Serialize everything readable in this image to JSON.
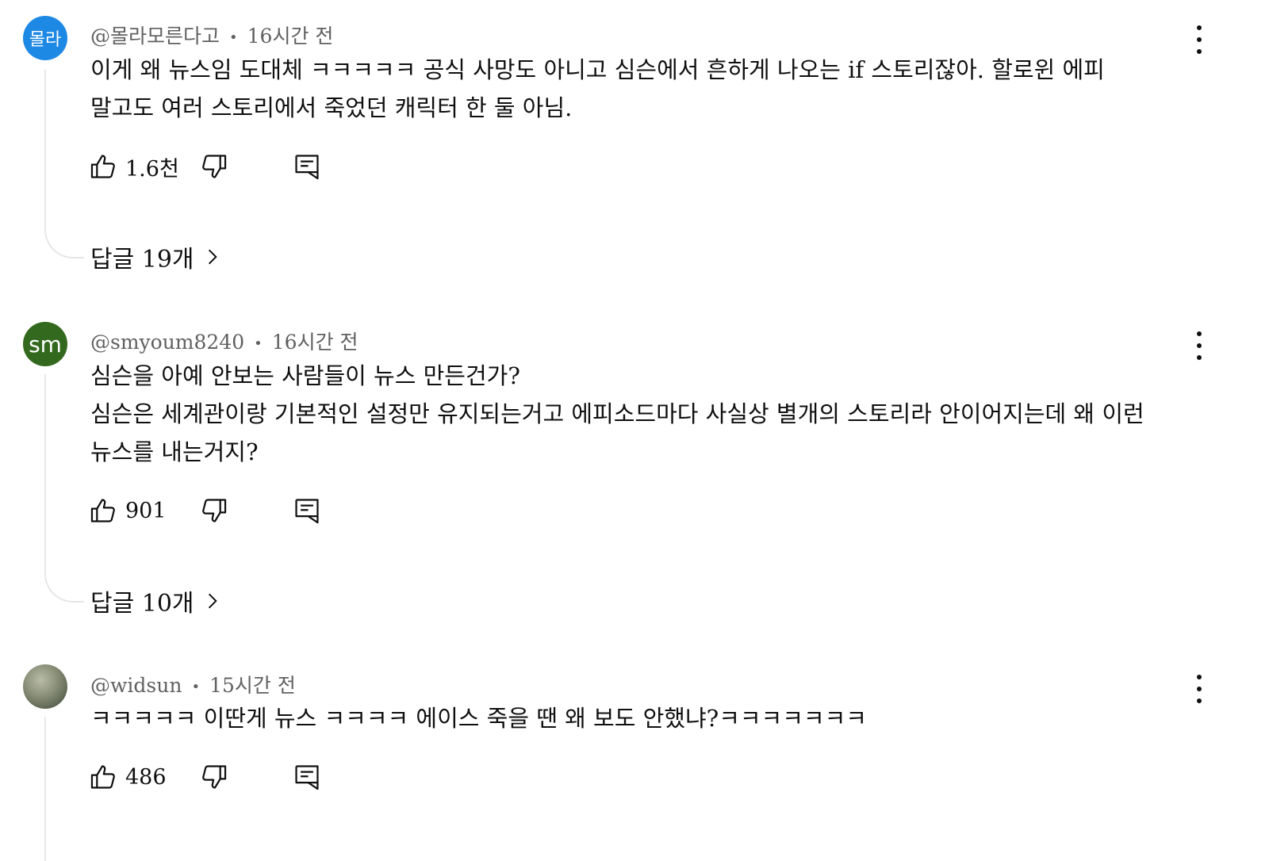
{
  "comments": [
    {
      "avatar_text": "몰라",
      "avatar_color": "#1e88e5",
      "author": "@몰라모른다고",
      "time": "16시간 전",
      "text": "이게 왜 뉴스임 도대체 ㅋㅋㅋㅋㅋ 공식 사망도 아니고 심슨에서 흔하게 나오는 if 스토리잖아. 할로윈 에피\n말고도 여러 스토리에서 죽었던 캐릭터 한 둘 아님.",
      "likes": "1.6천",
      "replies": "답글 19개"
    },
    {
      "avatar_text": "sm",
      "avatar_color": "#33691e",
      "author": "@smyoum8240",
      "time": "16시간 전",
      "text": "심슨을 아예 안보는 사람들이 뉴스 만든건가?\n심슨은 세계관이랑 기본적인 설정만 유지되는거고 에피소드마다 사실상 별개의 스토리라 안이어지는데 왜 이런\n뉴스를 내는거지?",
      "likes": "901",
      "replies": "답글 10개"
    },
    {
      "avatar_text": "",
      "avatar_color": "#7a7f6a",
      "author": "@widsun",
      "time": "15시간 전",
      "text": "ㅋㅋㅋㅋㅋ 이딴게 뉴스 ㅋㅋㅋㅋ 에이스 죽을 땐 왜 보도 안했냐?ㅋㅋㅋㅋㅋㅋㅋ",
      "likes": "486",
      "replies": ""
    }
  ],
  "icons": {
    "like": "thumbs-up-icon",
    "dislike": "thumbs-down-icon",
    "reply": "reply-comment-icon",
    "more": "more-vertical-icon",
    "chevron": "chevron-right-icon"
  }
}
